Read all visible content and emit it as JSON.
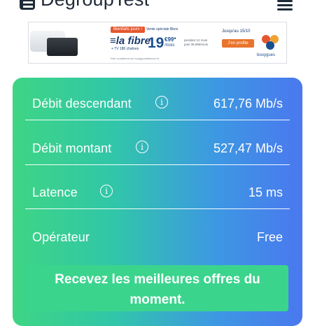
{
  "header": {
    "site_name": "DegroupTest",
    "logo_icon": "degrouptest-logo-icon",
    "menu_icon": "hamburger-menu-icon"
  },
  "banner": {
    "tag": "Bienfaits jours !",
    "tag2": "Vente spéciale Bbox",
    "product": "la fibre",
    "product_sub": "+ TV 180 chaînes",
    "price": "19",
    "price_cents": "€99*",
    "price_period": "/mois",
    "conditions": "pendant 12 mois puis 35,99€/mois",
    "date": "Jusqu'au 15/10",
    "cta": "J'en profite",
    "brand": "bouygues",
    "legal": "*Voir conditions sur bouyguestelecom.fr",
    "brand_color": "#1a4f8f",
    "accent_color": "#e9742b"
  },
  "results": {
    "rows": [
      {
        "label": "Débit descendant",
        "value": "617,76 Mb/s",
        "has_info": true
      },
      {
        "label": "Débit montant",
        "value": "527,47 Mb/s",
        "has_info": true
      },
      {
        "label": "Latence",
        "value": "15 ms",
        "has_info": true
      },
      {
        "label": "Opérateur",
        "value": "Free",
        "has_info": false
      }
    ],
    "info_symbol": "i",
    "cta": "Recevez les meilleures offres du moment.",
    "gradient_colors": [
      "#3ed584",
      "#31c6a9",
      "#3d98e3",
      "#4a78ef"
    ],
    "cta_color": "#3bd48d"
  }
}
